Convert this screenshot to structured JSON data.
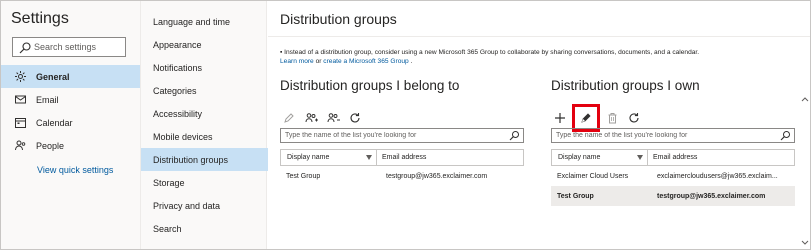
{
  "settings": {
    "title": "Settings",
    "search_placeholder": "Search settings",
    "categories": [
      {
        "label": "General",
        "icon": "gear-icon",
        "active": true
      },
      {
        "label": "Email",
        "icon": "mail-icon",
        "active": false
      },
      {
        "label": "Calendar",
        "icon": "calendar-icon",
        "active": false
      },
      {
        "label": "People",
        "icon": "people-icon",
        "active": false
      }
    ],
    "quick_settings_link": "View quick settings"
  },
  "general_nav": [
    {
      "label": "Language and time",
      "active": false
    },
    {
      "label": "Appearance",
      "active": false
    },
    {
      "label": "Notifications",
      "active": false
    },
    {
      "label": "Categories",
      "active": false
    },
    {
      "label": "Accessibility",
      "active": false
    },
    {
      "label": "Mobile devices",
      "active": false
    },
    {
      "label": "Distribution groups",
      "active": true
    },
    {
      "label": "Storage",
      "active": false
    },
    {
      "label": "Privacy and data",
      "active": false
    },
    {
      "label": "Search",
      "active": false
    }
  ],
  "main": {
    "title": "Distribution groups",
    "notice": {
      "text": "Instead of a distribution group, consider using a new Microsoft 365 Group to collaborate by sharing conversations, documents, and a calendar.",
      "learn_more": "Learn more",
      "or": "or",
      "create_link": "create a Microsoft 365 Group",
      "end": "."
    },
    "belong": {
      "heading": "Distribution groups I belong to",
      "search_placeholder": "Type the name of the list you're looking for",
      "col_display": "Display name",
      "col_email": "Email address",
      "rows": [
        {
          "name": "Test Group",
          "email": "testgroup@jw365.exclaimer.com",
          "selected": false
        }
      ]
    },
    "own": {
      "heading": "Distribution groups I own",
      "search_placeholder": "Type the name of the list you're looking for",
      "col_display": "Display name",
      "col_email": "Email address",
      "rows": [
        {
          "name": "Exclaimer Cloud Users",
          "email": "exclaimercloudusers@jw365.exclaim...",
          "selected": false
        },
        {
          "name": "Test Group",
          "email": "testgroup@jw365.exclaimer.com",
          "selected": true
        }
      ]
    }
  },
  "colors": {
    "active_bg": "#c7e0f4",
    "link": "#005a9e",
    "highlight": "#e3000f",
    "selected_row": "#edebe9"
  }
}
